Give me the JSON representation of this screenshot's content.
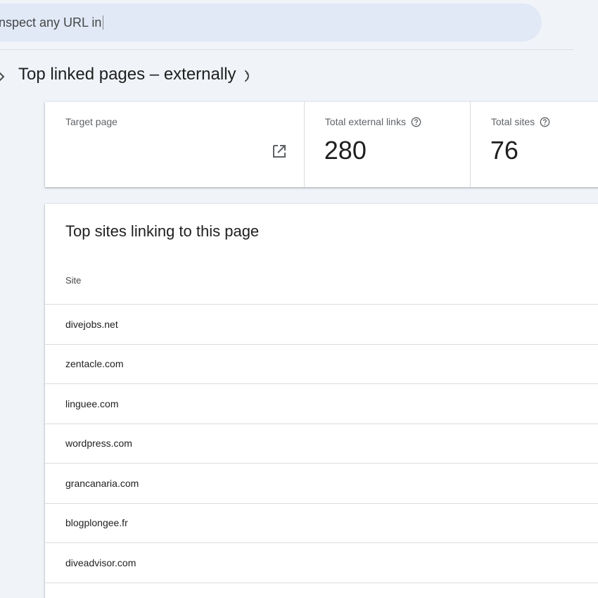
{
  "search": {
    "text": "nspect any URL in"
  },
  "page_title": "Top linked pages – externally",
  "summary": {
    "target_label": "Target page",
    "links_label": "Total external links",
    "links_value": "280",
    "sites_label": "Total sites",
    "sites_value": "76"
  },
  "sites_table": {
    "title": "Top sites linking to this page",
    "column_header": "Site",
    "rows": [
      "divejobs.net",
      "zentacle.com",
      "linguee.com",
      "wordpress.com",
      "grancanaria.com",
      "blogplongee.fr",
      "diveadvisor.com",
      "..."
    ]
  },
  "icons": {
    "back": "chevron-right-icon",
    "help": "help-circle-icon",
    "open": "open-in-new-icon"
  },
  "colors": {
    "background": "#f0f4f9",
    "search_bg": "#e1e9f7",
    "card_bg": "#ffffff",
    "divider": "#dadce0"
  }
}
